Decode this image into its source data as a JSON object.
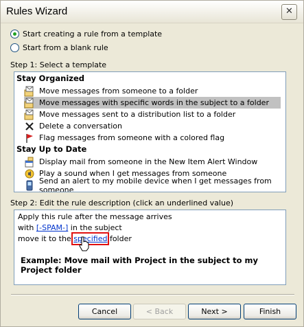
{
  "window": {
    "title": "Rules Wizard"
  },
  "options": {
    "template_label": "Start creating a rule from a template",
    "blank_label": "Start from a blank rule",
    "selected": "template"
  },
  "step1": {
    "label": "Step 1: Select a template",
    "groups": [
      {
        "name": "Stay Organized",
        "items": [
          {
            "label": "Move messages from someone to a folder",
            "icon": "envelope-folder-icon"
          },
          {
            "label": "Move messages with specific words in the subject to a folder",
            "icon": "envelope-folder-icon",
            "selected": true
          },
          {
            "label": "Move messages sent to a distribution list to a folder",
            "icon": "envelope-folder-icon"
          },
          {
            "label": "Delete a conversation",
            "icon": "delete-x-icon"
          },
          {
            "label": "Flag messages from someone with a colored flag",
            "icon": "red-flag-icon"
          }
        ]
      },
      {
        "name": "Stay Up to Date",
        "items": [
          {
            "label": "Display mail from someone in the New Item Alert Window",
            "icon": "alert-window-icon"
          },
          {
            "label": "Play a sound when I get messages from someone",
            "icon": "sound-icon"
          },
          {
            "label": "Send an alert to my mobile device when I get messages from someone",
            "icon": "mobile-device-icon"
          }
        ]
      }
    ]
  },
  "step2": {
    "label": "Step 2: Edit the rule description (click an underlined value)",
    "line1": "Apply this rule after the message arrives",
    "line2_prefix": "with ",
    "line2_link": "[-SPAM-]",
    "line2_suffix": " in the subject",
    "line3_prefix": "move it to the ",
    "line3_link": "specified",
    "line3_suffix": " folder",
    "example": "Example: Move mail with Project in the subject to my Project folder"
  },
  "buttons": {
    "cancel": "Cancel",
    "back": "< Back",
    "next": "Next >",
    "finish": "Finish"
  }
}
